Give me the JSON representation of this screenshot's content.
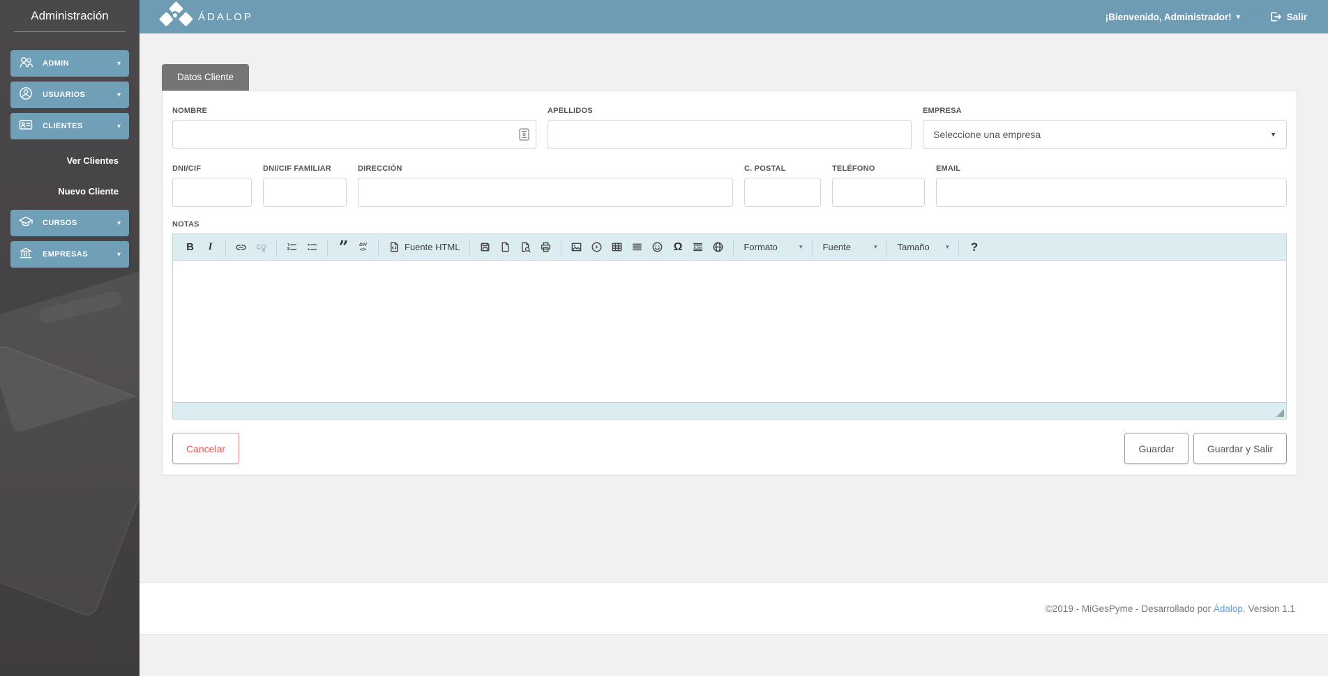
{
  "sidebar": {
    "title": "Administración",
    "items": [
      {
        "label": "ADMIN",
        "icon": "users-icon"
      },
      {
        "label": "USUARIOS",
        "icon": "user-circle-icon"
      },
      {
        "label": "CLIENTES",
        "icon": "id-card-icon"
      },
      {
        "label": "CURSOS",
        "icon": "graduation-cap-icon"
      },
      {
        "label": "EMPRESAS",
        "icon": "bank-icon"
      }
    ],
    "clientes_submenu": [
      {
        "label": "Ver Clientes"
      },
      {
        "label": "Nuevo Cliente"
      }
    ]
  },
  "header": {
    "brand_wordmark": "ÁDALOP",
    "welcome": "¡Bienvenido, Administrador!",
    "logout_label": "Salir"
  },
  "page": {
    "tab_label": "Datos Cliente"
  },
  "form": {
    "nombre": {
      "label": "NOMBRE",
      "value": ""
    },
    "apellidos": {
      "label": "APELLIDOS",
      "value": ""
    },
    "empresa": {
      "label": "EMPRESA",
      "selected": "Seleccione una empresa"
    },
    "dni": {
      "label": "DNI/CIF",
      "value": ""
    },
    "dni_familiar": {
      "label": "DNI/CIF FAMILIAR",
      "value": ""
    },
    "direccion": {
      "label": "DIRECCIÓN",
      "value": ""
    },
    "c_postal": {
      "label": "C. POSTAL",
      "value": ""
    },
    "telefono": {
      "label": "TELÉFONO",
      "value": ""
    },
    "email": {
      "label": "EMAIL",
      "value": ""
    },
    "notas": {
      "label": "NOTAS",
      "value": ""
    }
  },
  "editor": {
    "source_label": "Fuente HTML",
    "format_label": "Formato",
    "font_label": "Fuente",
    "size_label": "Tamaño",
    "bold_glyph": "B",
    "italic_glyph": "I",
    "quote_glyph": "”",
    "omega_glyph": "Ω",
    "help_glyph": "?",
    "div_glyph_top": "DIV",
    "div_glyph_bottom": "</>",
    "toolbar_icons": [
      "bold",
      "italic",
      "link",
      "unlink",
      "numbered-list",
      "bulleted-list",
      "blockquote",
      "div-container",
      "source-html",
      "save",
      "new-page",
      "preview",
      "print",
      "image",
      "flash",
      "table",
      "horizontal-rule",
      "smiley",
      "special-character",
      "page-break",
      "iframe-globe",
      "format-dropdown",
      "font-dropdown",
      "size-dropdown",
      "about-help"
    ]
  },
  "glyphs": {
    "caret_down_small": "▾",
    "select_arrow": "▼"
  },
  "actions": {
    "cancel_label": "Cancelar",
    "save_label": "Guardar",
    "save_exit_label": "Guardar y Salir"
  },
  "footer": {
    "text_prefix": "©2019 - MiGesPyme - Desarrollado por ",
    "link_text": "Ádalop",
    "text_suffix": ". Version 1.1"
  },
  "colors": {
    "header_blue": "#6d9cb4",
    "sidebar_button_blue": "#6fa0b7",
    "sidebar_bg": "#454245",
    "tab_gray": "#757575",
    "toolbar_bg": "#dcedf2",
    "cancel_red": "#ef5350",
    "link_blue": "#5f9fe0",
    "page_bg": "#f1f1f2"
  }
}
